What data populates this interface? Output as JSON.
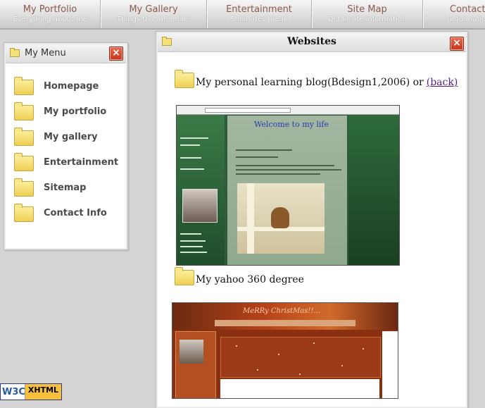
{
  "nav": [
    {
      "title": "My Portfolio",
      "subtitle": "Everything about me"
    },
    {
      "title": "My Gallery",
      "subtitle": "Things that are mine"
    },
    {
      "title": "Entertainment",
      "subtitle": "5 minutes break"
    },
    {
      "title": "Site Map",
      "subtitle": "Detail site information"
    },
    {
      "title": "Contact I",
      "subtitle": "information ab"
    }
  ],
  "menu_window": {
    "title": "My Menu",
    "close": "×",
    "items": [
      {
        "label": "Homepage"
      },
      {
        "label": "My portfolio"
      },
      {
        "label": "My gallery"
      },
      {
        "label": "Entertainment"
      },
      {
        "label": "Sitemap"
      },
      {
        "label": "Contact Info"
      }
    ]
  },
  "websites_window": {
    "title": "Websites",
    "close": "×",
    "entry1": {
      "text": "My personal learning blog(Bdesign1,2006) or",
      "link": "(back)"
    },
    "shot1_welcome": "Welcome to my life",
    "entry2": {
      "text": "My yahoo 360 degree"
    },
    "shot2_banner": "MeRRy ChristMas!!..."
  },
  "badge": {
    "w3c": "W3C",
    "xhtml": "XHTML"
  }
}
